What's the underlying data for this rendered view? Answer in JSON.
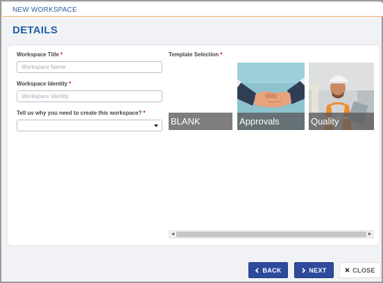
{
  "header": {
    "title": "NEW WORKSPACE"
  },
  "section": {
    "title": "DETAILS"
  },
  "form": {
    "title_label": "Workspace Title",
    "title_placeholder": "Workspace Name",
    "title_value": "",
    "identity_label": "Workspace Identity",
    "identity_placeholder": "Workspace Identity",
    "identity_value": "",
    "reason_label": "Tell us why you need to create this workspace?",
    "reason_value": "",
    "required_mark": "*"
  },
  "templates": {
    "label": "Template Selection",
    "items": [
      {
        "label": "BLANK"
      },
      {
        "label": "Approvals"
      },
      {
        "label": "Quality"
      }
    ]
  },
  "footer": {
    "back_label": "BACK",
    "next_label": "NEXT",
    "close_label": "CLOSE"
  },
  "colors": {
    "primary": "#2d4a9b",
    "title_blue": "#1f5fa5",
    "required_red": "#d0021b",
    "accent_orange": "#f0b36b"
  },
  "icons": {
    "back": "chevron-left-icon",
    "next": "chevron-right-icon",
    "close": "close-icon",
    "select": "caret-down-icon"
  }
}
